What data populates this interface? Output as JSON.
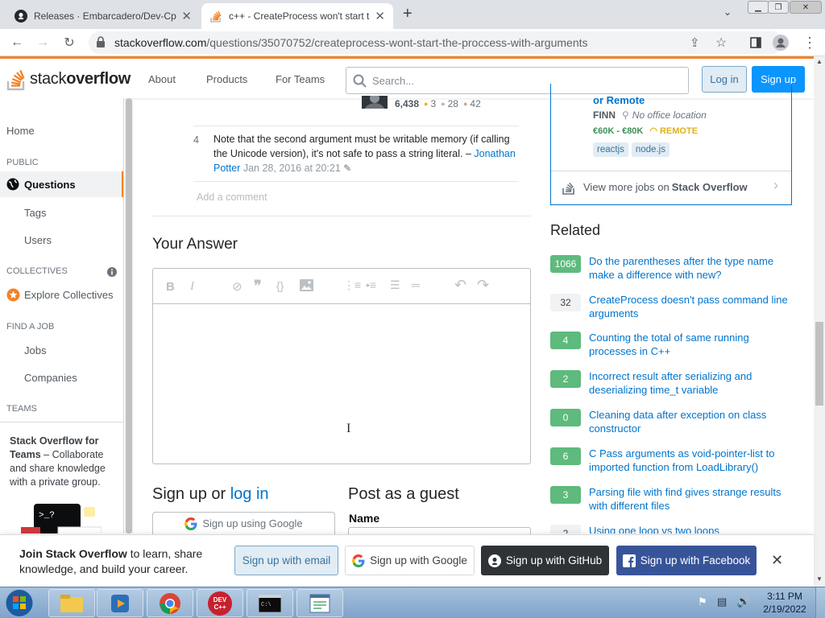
{
  "browser": {
    "tabs": [
      {
        "title": "Releases · Embarcadero/Dev-Cpp",
        "favicon": "github-icon"
      },
      {
        "title": "c++ - CreateProcess won't start t",
        "favicon": "stackoverflow-icon"
      }
    ],
    "url_host": "stackoverflow.com",
    "url_path": "/questions/35070752/createprocess-wont-start-the-proccess-with-arguments"
  },
  "header": {
    "logo_stack": "stack",
    "logo_overflow": "overflow",
    "nav": [
      "About",
      "Products",
      "For Teams"
    ],
    "search_placeholder": "Search...",
    "login": "Log in",
    "signup": "Sign up"
  },
  "sidebar": {
    "home": "Home",
    "public": "PUBLIC",
    "questions": "Questions",
    "tags": "Tags",
    "users": "Users",
    "collectives": "COLLECTIVES",
    "explore": "Explore Collectives",
    "find_job": "FIND A JOB",
    "jobs": "Jobs",
    "companies": "Companies",
    "teams": "TEAMS",
    "teams_title": "Stack Overflow for Teams",
    "teams_desc": " – Collaborate and share knowledge with a private group."
  },
  "user_card": {
    "rep": "6,438",
    "gold": "3",
    "silver": "28",
    "bronze": "42"
  },
  "comment": {
    "score": "4",
    "text": "Note that the second argument must be writable memory (if calling the Unicode version), it's not safe to pass a string literal.",
    "dash": "–",
    "author": "Jonathan Potter",
    "date": "Jan 28, 2016 at 20:21",
    "add": "Add a comment"
  },
  "answer": {
    "heading": "Your Answer",
    "signup_text": "Sign up or ",
    "login_link": "log in",
    "guest_heading": "Post as a guest",
    "name_label": "Name",
    "google_btn": "Sign up using Google"
  },
  "job": {
    "title_tail": "or Remote",
    "company": "FINN",
    "location": "No office location",
    "salary": "€60K - €80K",
    "remote": "REMOTE",
    "tags": [
      "reactjs",
      "node.js"
    ],
    "more_prefix": "View more jobs on ",
    "more_brand": "Stack Overflow"
  },
  "related": {
    "heading": "Related",
    "items": [
      {
        "score": "1066",
        "answered": true,
        "title": "Do the parentheses after the type name make a difference with new?"
      },
      {
        "score": "32",
        "answered": false,
        "title": "CreateProcess doesn't pass command line arguments"
      },
      {
        "score": "4",
        "answered": true,
        "title": "Counting the total of same running processes in C++"
      },
      {
        "score": "2",
        "answered": true,
        "title": "Incorrect result after serializing and deserializing time_t variable"
      },
      {
        "score": "0",
        "answered": true,
        "title": "Cleaning data after exception on class constructor"
      },
      {
        "score": "6",
        "answered": true,
        "title": "C Pass arguments as void-pointer-list to imported function from LoadLibrary()"
      },
      {
        "score": "3",
        "answered": true,
        "title": "Parsing file with find gives strange results with different files"
      },
      {
        "score": "2",
        "answered": false,
        "title": "Using one loop vs two loops"
      }
    ]
  },
  "banner": {
    "join_bold": "Join Stack Overflow",
    "join_rest": " to learn, share knowledge, and build your career.",
    "email": "Sign up with email",
    "google": "Sign up with Google",
    "github": "Sign up with GitHub",
    "facebook": "Sign up with Facebook"
  },
  "taskbar": {
    "time": "3:11 PM",
    "date": "2/19/2022",
    "devcpp": "DEV C++"
  },
  "colors": {
    "orange": "#f48225",
    "link": "#0074cc",
    "answered": "#5eba7d",
    "github": "#2f3337",
    "facebook": "#385499"
  }
}
